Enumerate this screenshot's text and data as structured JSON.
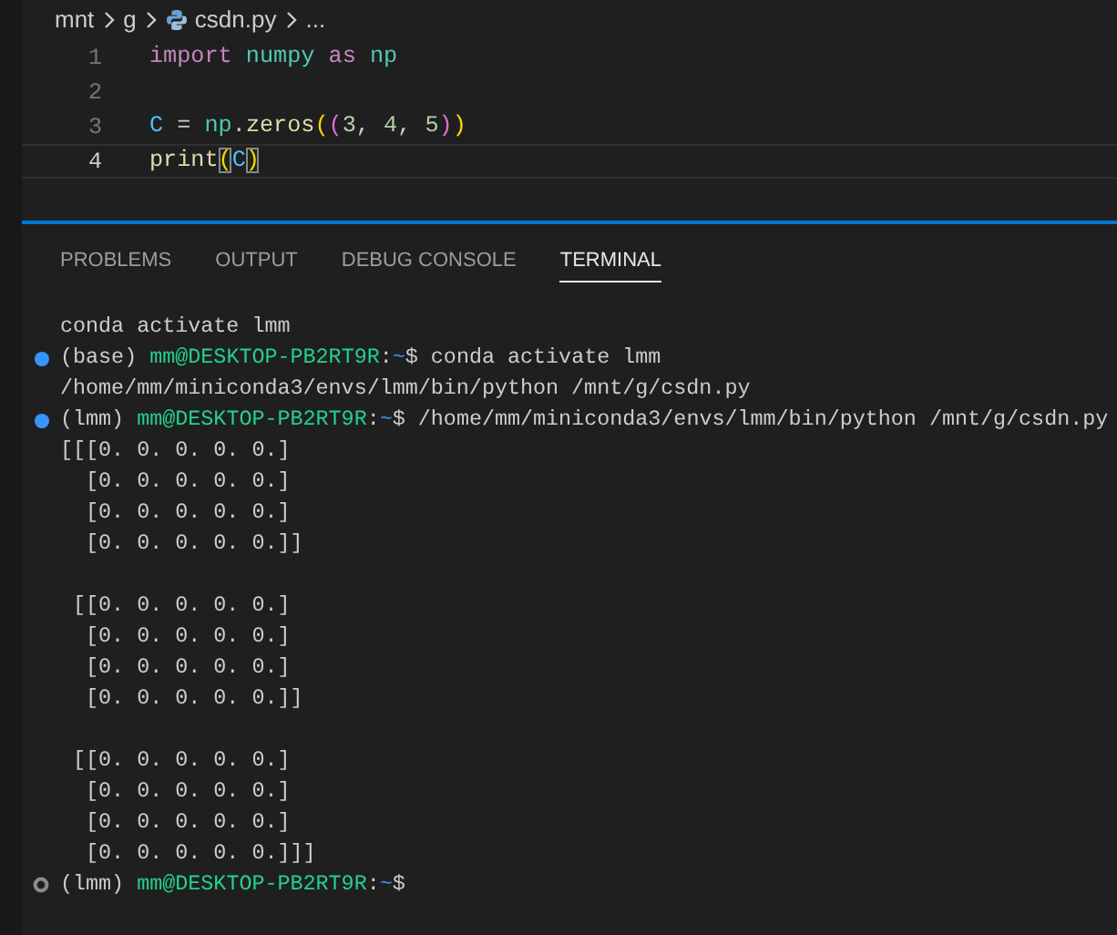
{
  "breadcrumb": {
    "items": [
      {
        "kind": "folder",
        "text": "mnt"
      },
      {
        "kind": "folder",
        "text": "g"
      },
      {
        "kind": "python-file",
        "text": "csdn.py"
      },
      {
        "kind": "more",
        "text": "..."
      }
    ]
  },
  "editor": {
    "lines": [
      {
        "number": "1",
        "current": false,
        "tokens": [
          {
            "t": "import ",
            "kind": "keyword"
          },
          {
            "t": "numpy ",
            "kind": "module"
          },
          {
            "t": "as ",
            "kind": "keyword"
          },
          {
            "t": "np",
            "kind": "module"
          }
        ]
      },
      {
        "number": "2",
        "current": false
      },
      {
        "number": "3",
        "current": false,
        "tokens": [
          {
            "t": "C",
            "kind": "variable"
          },
          {
            "t": " = ",
            "kind": "operator"
          },
          {
            "t": "np",
            "kind": "module"
          },
          {
            "t": ".",
            "kind": "operator"
          },
          {
            "t": "zeros",
            "kind": "function"
          },
          {
            "t": "(",
            "kind": "bracket1"
          },
          {
            "t": "(",
            "kind": "bracket2"
          },
          {
            "t": "3",
            "kind": "number"
          },
          {
            "t": ", ",
            "kind": "operator"
          },
          {
            "t": "4",
            "kind": "number"
          },
          {
            "t": ", ",
            "kind": "operator"
          },
          {
            "t": "5",
            "kind": "number"
          },
          {
            "t": ")",
            "kind": "bracket2"
          },
          {
            "t": ")",
            "kind": "bracket1"
          }
        ]
      },
      {
        "number": "4",
        "current": true,
        "tokens": [
          {
            "t": "print",
            "kind": "function"
          },
          {
            "t": "(",
            "kind": "bracket1",
            "matched": true
          },
          {
            "t": "C",
            "kind": "variable"
          },
          {
            "t": ")",
            "kind": "bracket1",
            "matched": true
          }
        ]
      }
    ]
  },
  "panel": {
    "tabs": [
      {
        "label": "PROBLEMS",
        "selected": false
      },
      {
        "label": "OUTPUT",
        "selected": false
      },
      {
        "label": "DEBUG CONSOLE",
        "selected": false
      },
      {
        "label": "TERMINAL",
        "selected": true
      }
    ],
    "terminal": {
      "lines": [
        {
          "kind": "output",
          "segments": [
            {
              "text": "conda activate lmm",
              "kind": "output"
            }
          ]
        },
        {
          "kind": "success",
          "segments": [
            {
              "text": "(base) ",
              "kind": "output"
            },
            {
              "text": "mm@DESKTOP-PB2RT9R",
              "kind": "user"
            },
            {
              "text": ":",
              "kind": "output"
            },
            {
              "text": "~",
              "kind": "path"
            },
            {
              "text": "$ conda activate lmm",
              "kind": "output"
            }
          ]
        },
        {
          "kind": "output",
          "segments": [
            {
              "text": "/home/mm/miniconda3/envs/lmm/bin/python /mnt/g/csdn.py",
              "kind": "output"
            }
          ]
        },
        {
          "kind": "success",
          "segments": [
            {
              "text": "(lmm) ",
              "kind": "output"
            },
            {
              "text": "mm@DESKTOP-PB2RT9R",
              "kind": "user"
            },
            {
              "text": ":",
              "kind": "output"
            },
            {
              "text": "~",
              "kind": "path"
            },
            {
              "text": "$ /home/mm/miniconda3/envs/lmm/bin/python /mnt/g/csdn.py",
              "kind": "output"
            }
          ]
        },
        {
          "kind": "output",
          "segments": [
            {
              "text": "[[[0. 0. 0. 0. 0.]",
              "kind": "output"
            }
          ]
        },
        {
          "kind": "output",
          "segments": [
            {
              "text": "  [0. 0. 0. 0. 0.]",
              "kind": "output"
            }
          ]
        },
        {
          "kind": "output",
          "segments": [
            {
              "text": "  [0. 0. 0. 0. 0.]",
              "kind": "output"
            }
          ]
        },
        {
          "kind": "output",
          "segments": [
            {
              "text": "  [0. 0. 0. 0. 0.]]",
              "kind": "output"
            }
          ]
        },
        {
          "kind": "blank"
        },
        {
          "kind": "output",
          "segments": [
            {
              "text": " [[0. 0. 0. 0. 0.]",
              "kind": "output"
            }
          ]
        },
        {
          "kind": "output",
          "segments": [
            {
              "text": "  [0. 0. 0. 0. 0.]",
              "kind": "output"
            }
          ]
        },
        {
          "kind": "output",
          "segments": [
            {
              "text": "  [0. 0. 0. 0. 0.]",
              "kind": "output"
            }
          ]
        },
        {
          "kind": "output",
          "segments": [
            {
              "text": "  [0. 0. 0. 0. 0.]]",
              "kind": "output"
            }
          ]
        },
        {
          "kind": "blank"
        },
        {
          "kind": "output",
          "segments": [
            {
              "text": " [[0. 0. 0. 0. 0.]",
              "kind": "output"
            }
          ]
        },
        {
          "kind": "output",
          "segments": [
            {
              "text": "  [0. 0. 0. 0. 0.]",
              "kind": "output"
            }
          ]
        },
        {
          "kind": "output",
          "segments": [
            {
              "text": "  [0. 0. 0. 0. 0.]",
              "kind": "output"
            }
          ]
        },
        {
          "kind": "output",
          "segments": [
            {
              "text": "  [0. 0. 0. 0. 0.]]]",
              "kind": "output"
            }
          ]
        },
        {
          "kind": "pending",
          "segments": [
            {
              "text": "(lmm) ",
              "kind": "output"
            },
            {
              "text": "mm@DESKTOP-PB2RT9R",
              "kind": "user"
            },
            {
              "text": ":",
              "kind": "output"
            },
            {
              "text": "~",
              "kind": "path"
            },
            {
              "text": "$",
              "kind": "output"
            }
          ]
        }
      ]
    }
  }
}
